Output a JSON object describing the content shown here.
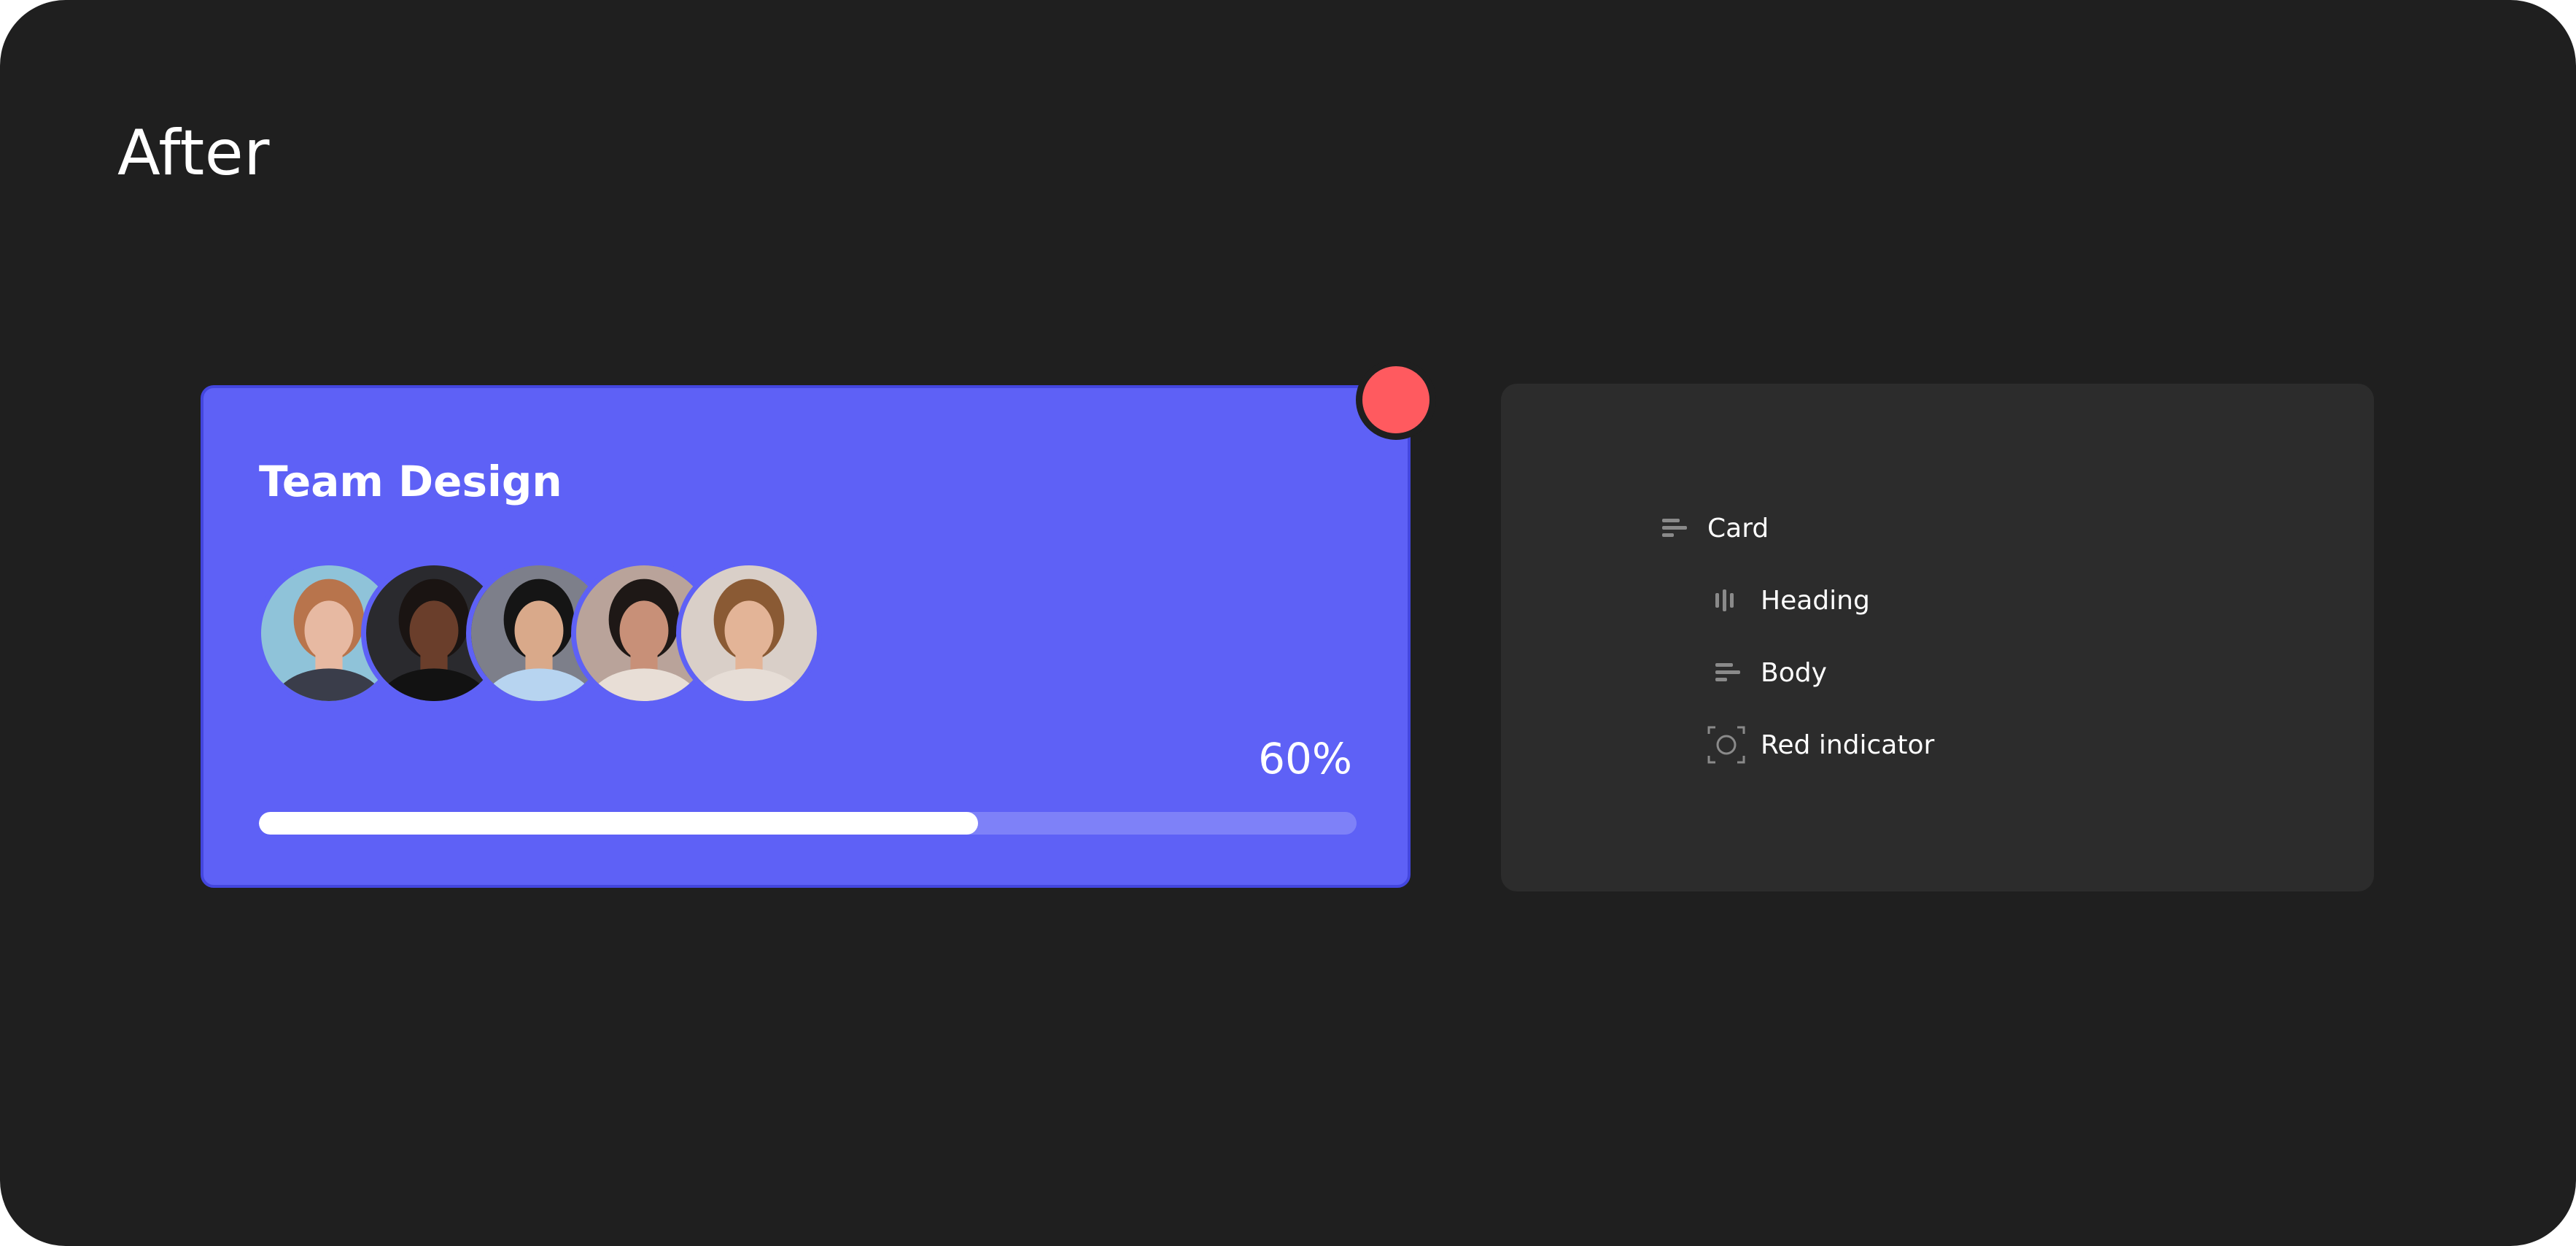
{
  "page": {
    "title": "After",
    "background": "#1f1f1f"
  },
  "card": {
    "heading": "Team Design",
    "background": "#5e61f6",
    "avatars": [
      {
        "name": "avatar-1",
        "skin": "#e7b9a2",
        "hair": "#b8744c",
        "bg": "#8fc3d9",
        "shirt": "#3a3d4a"
      },
      {
        "name": "avatar-2",
        "skin": "#6a3e2b",
        "hair": "#1a1412",
        "bg": "#2a2a2e",
        "shirt": "#121212"
      },
      {
        "name": "avatar-3",
        "skin": "#d9a98a",
        "hair": "#151515",
        "bg": "#7d7f8a",
        "shirt": "#b7d4f0"
      },
      {
        "name": "avatar-4",
        "skin": "#c89078",
        "hair": "#1e1816",
        "bg": "#b9a39a",
        "shirt": "#e8ded6"
      },
      {
        "name": "avatar-5",
        "skin": "#e3b497",
        "hair": "#8a5a34",
        "bg": "#d9cfc8",
        "shirt": "#e6ddd6"
      }
    ],
    "progress": {
      "label": "60%",
      "value": 0.655,
      "fill": "#ffffff",
      "track": "#7e81f8"
    },
    "indicator_color": "#ff5a5f"
  },
  "layers": {
    "items": [
      {
        "label": "Card",
        "icon": "align-left-icon"
      },
      {
        "label": "Heading",
        "icon": "align-bars-vertical-icon"
      },
      {
        "label": "Body",
        "icon": "align-left-icon"
      },
      {
        "label": "Red indicator",
        "icon": "frame-circle-icon"
      }
    ]
  }
}
